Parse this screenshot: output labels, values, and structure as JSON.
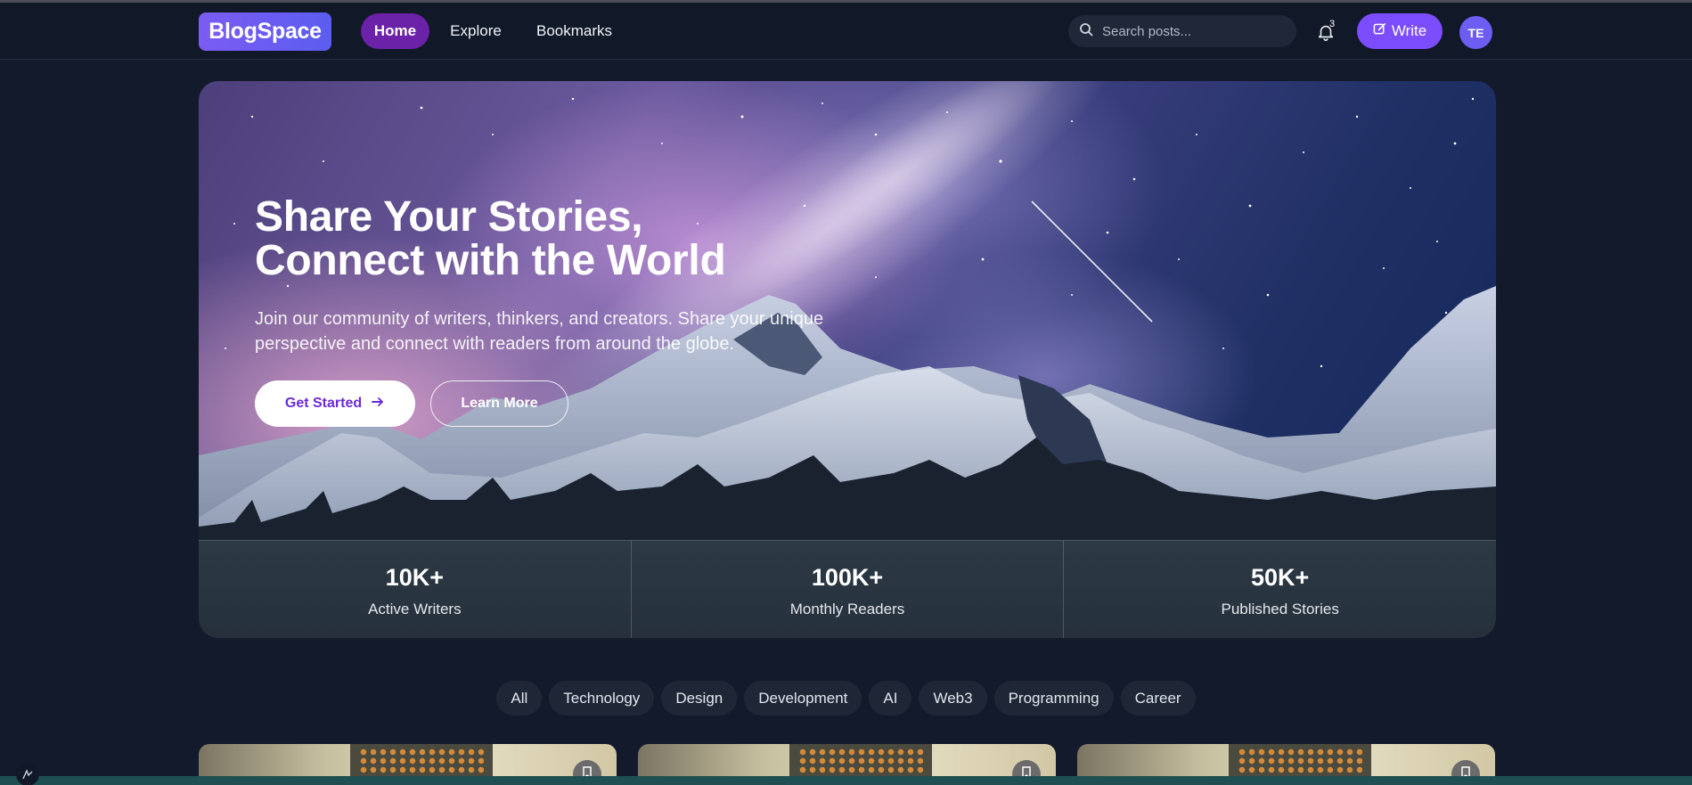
{
  "nav": {
    "logo": "BlogSpace",
    "links": [
      {
        "label": "Home",
        "active": true
      },
      {
        "label": "Explore",
        "active": false
      },
      {
        "label": "Bookmarks",
        "active": false
      }
    ],
    "search_placeholder": "Search posts...",
    "notification_count": "3",
    "write_label": "Write",
    "avatar_initials": "TE"
  },
  "hero": {
    "title_line1": "Share Your Stories,",
    "title_line2": "Connect with the World",
    "subtitle": "Join our community of writers, thinkers, and creators. Share your unique perspective and connect with readers from around the globe.",
    "primary_button": "Get Started",
    "secondary_button": "Learn More",
    "stats": [
      {
        "value": "10K+",
        "label": "Active Writers"
      },
      {
        "value": "100K+",
        "label": "Monthly Readers"
      },
      {
        "value": "50K+",
        "label": "Published Stories"
      }
    ]
  },
  "categories": [
    "All",
    "Technology",
    "Design",
    "Development",
    "AI",
    "Web3",
    "Programming",
    "Career"
  ],
  "icons": {
    "search": "search-icon",
    "bell": "bell-icon",
    "write": "edit-icon",
    "arrow": "arrow-right-icon",
    "bookmark": "bookmark-icon"
  },
  "colors": {
    "background": "#131a2c",
    "nav_background": "#111827",
    "accent": "#7c4dff",
    "active_link": "#6b21a8",
    "chip_background": "#1f2737"
  }
}
